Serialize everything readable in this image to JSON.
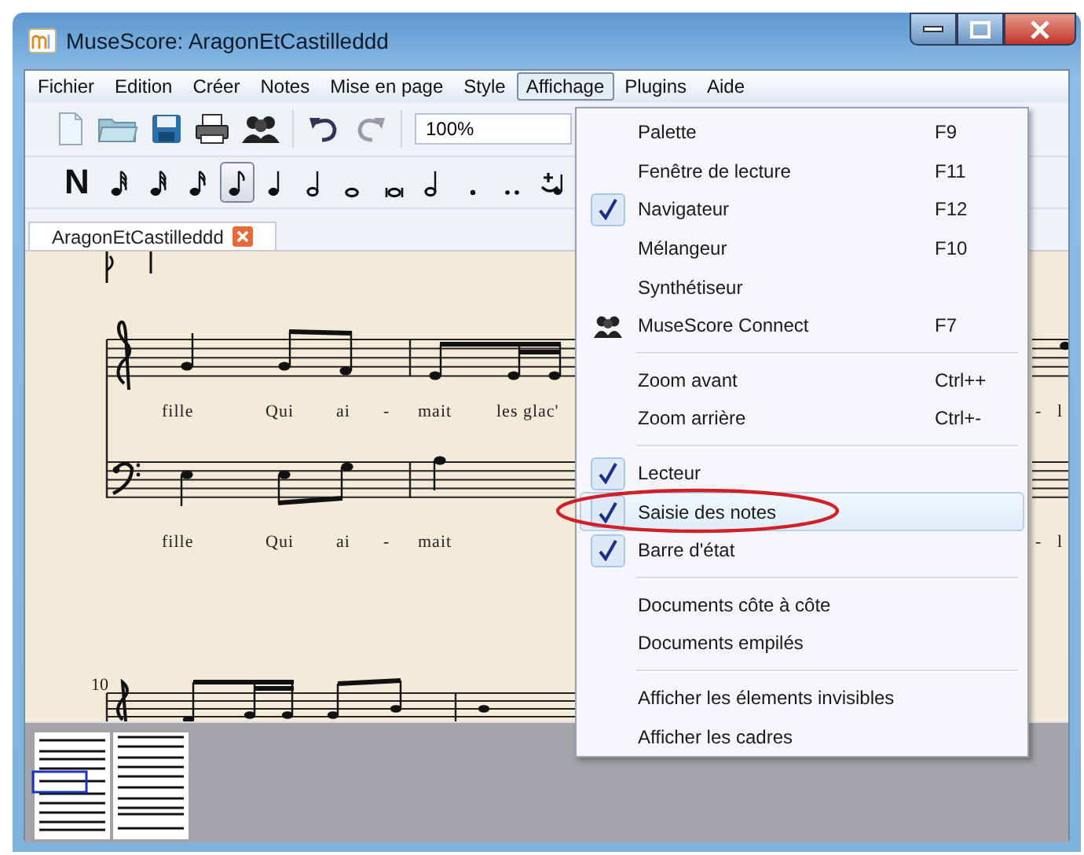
{
  "window": {
    "title": "MuseScore: AragonEtCastilleddd"
  },
  "menu_bar": [
    {
      "label": "Fichier",
      "selected": false
    },
    {
      "label": "Edition",
      "selected": false
    },
    {
      "label": "Créer",
      "selected": false
    },
    {
      "label": "Notes",
      "selected": false
    },
    {
      "label": "Mise en page",
      "selected": false
    },
    {
      "label": "Style",
      "selected": false
    },
    {
      "label": "Affichage",
      "selected": true
    },
    {
      "label": "Plugins",
      "selected": false
    },
    {
      "label": "Aide",
      "selected": false
    }
  ],
  "zoom_field": {
    "value": "100%"
  },
  "note_input": {
    "label": "N"
  },
  "note_buttons": [
    {
      "kind": "sixtyfourth",
      "selected": false
    },
    {
      "kind": "thirtysecond",
      "selected": false
    },
    {
      "kind": "sixteenth",
      "selected": false
    },
    {
      "kind": "eighth",
      "selected": true
    },
    {
      "kind": "quarter",
      "selected": false
    },
    {
      "kind": "half",
      "selected": false
    },
    {
      "kind": "whole",
      "selected": false
    },
    {
      "kind": "breve",
      "selected": false
    },
    {
      "kind": "longa",
      "selected": false
    },
    {
      "kind": "dot",
      "selected": false
    },
    {
      "kind": "doubledot",
      "selected": false
    },
    {
      "kind": "tie",
      "selected": false
    }
  ],
  "tab": {
    "label": "AragonEtCastilleddd"
  },
  "score": {
    "measure_number": "10",
    "treble_lyrics": [
      "fille",
      "Qui",
      "ai",
      "-",
      "mait",
      "les glac'"
    ],
    "treble_lyrics_right": [
      "-",
      "l"
    ],
    "bass_lyrics": [
      "fille",
      "Qui",
      "ai",
      "-",
      "mait"
    ],
    "bass_lyrics_right": [
      "-",
      "l"
    ]
  },
  "view_menu": {
    "items": [
      {
        "kind": "item",
        "label": "Palette",
        "shortcut": "F9",
        "checked": false,
        "highlighted": false,
        "circled": false
      },
      {
        "kind": "item",
        "label": "Fenêtre de lecture",
        "shortcut": "F11",
        "checked": false,
        "highlighted": false,
        "circled": false
      },
      {
        "kind": "item",
        "label": "Navigateur",
        "shortcut": "F12",
        "checked": true,
        "highlighted": false,
        "circled": false
      },
      {
        "kind": "item",
        "label": "Mélangeur",
        "shortcut": "F10",
        "checked": false,
        "highlighted": false,
        "circled": false
      },
      {
        "kind": "item",
        "label": "Synthétiseur",
        "checked": false,
        "highlighted": false,
        "circled": false
      },
      {
        "kind": "icon_item",
        "label": "MuseScore Connect",
        "shortcut": "F7",
        "checked": false,
        "highlighted": false,
        "circled": false
      },
      {
        "kind": "separator"
      },
      {
        "kind": "item",
        "label": "Zoom avant",
        "shortcut": "Ctrl++",
        "checked": false,
        "highlighted": false,
        "circled": false
      },
      {
        "kind": "item",
        "label": "Zoom arrière",
        "shortcut": "Ctrl+-",
        "checked": false,
        "highlighted": false,
        "circled": false
      },
      {
        "kind": "separator"
      },
      {
        "kind": "item",
        "label": "Lecteur",
        "checked": true,
        "highlighted": false,
        "circled": false
      },
      {
        "kind": "item",
        "label": "Saisie des notes",
        "checked": true,
        "highlighted": true,
        "circled": true
      },
      {
        "kind": "item",
        "label": "Barre d'état",
        "checked": true,
        "highlighted": false,
        "circled": false
      },
      {
        "kind": "separator"
      },
      {
        "kind": "item",
        "label": "Documents côte à côte",
        "checked": false,
        "highlighted": false,
        "circled": false
      },
      {
        "kind": "item",
        "label": "Documents empilés",
        "checked": false,
        "highlighted": false,
        "circled": false
      },
      {
        "kind": "separator"
      },
      {
        "kind": "item",
        "label": "Afficher les élements invisibles",
        "checked": false,
        "highlighted": false,
        "circled": false
      },
      {
        "kind": "item",
        "label": "Afficher les cadres",
        "checked": false,
        "highlighted": false,
        "circled": false
      }
    ]
  }
}
